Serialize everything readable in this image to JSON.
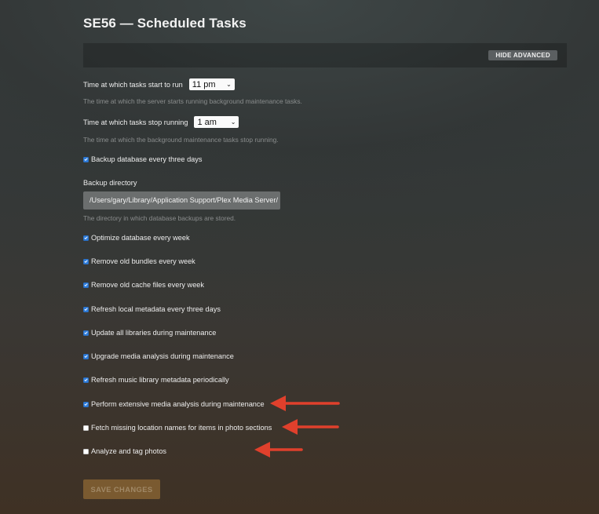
{
  "header": {
    "title": "SE56 — Scheduled Tasks"
  },
  "advanced": {
    "button_label": "HIDE ADVANCED"
  },
  "start_time": {
    "label": "Time at which tasks start to run",
    "value": "11 pm",
    "help": "The time at which the server starts running background maintenance tasks."
  },
  "stop_time": {
    "label": "Time at which tasks stop running",
    "value": "1 am",
    "help": "The time at which the background maintenance tasks stop running."
  },
  "backup": {
    "label": "Backup database every three days",
    "checked": true
  },
  "backup_directory": {
    "label": "Backup directory",
    "value": "/Users/gary/Library/Application Support/Plex Media Server/",
    "help": "The directory in which database backups are stored."
  },
  "options": [
    {
      "label": "Optimize database every week",
      "checked": true
    },
    {
      "label": "Remove old bundles every week",
      "checked": true
    },
    {
      "label": "Remove old cache files every week",
      "checked": true
    },
    {
      "label": "Refresh local metadata every three days",
      "checked": true
    },
    {
      "label": "Update all libraries during maintenance",
      "checked": true
    },
    {
      "label": "Upgrade media analysis during maintenance",
      "checked": true
    },
    {
      "label": "Refresh music library metadata periodically",
      "checked": true
    },
    {
      "label": "Perform extensive media analysis during maintenance",
      "checked": true
    },
    {
      "label": "Fetch missing location names for items in photo sections",
      "checked": false
    },
    {
      "label": "Analyze and tag photos",
      "checked": false
    }
  ],
  "save": {
    "label": "SAVE CHANGES"
  },
  "colors": {
    "checkbox_checked": "#2f7ddc",
    "annotation_arrow": "#e0402c",
    "save_button": "#7a5a30"
  }
}
